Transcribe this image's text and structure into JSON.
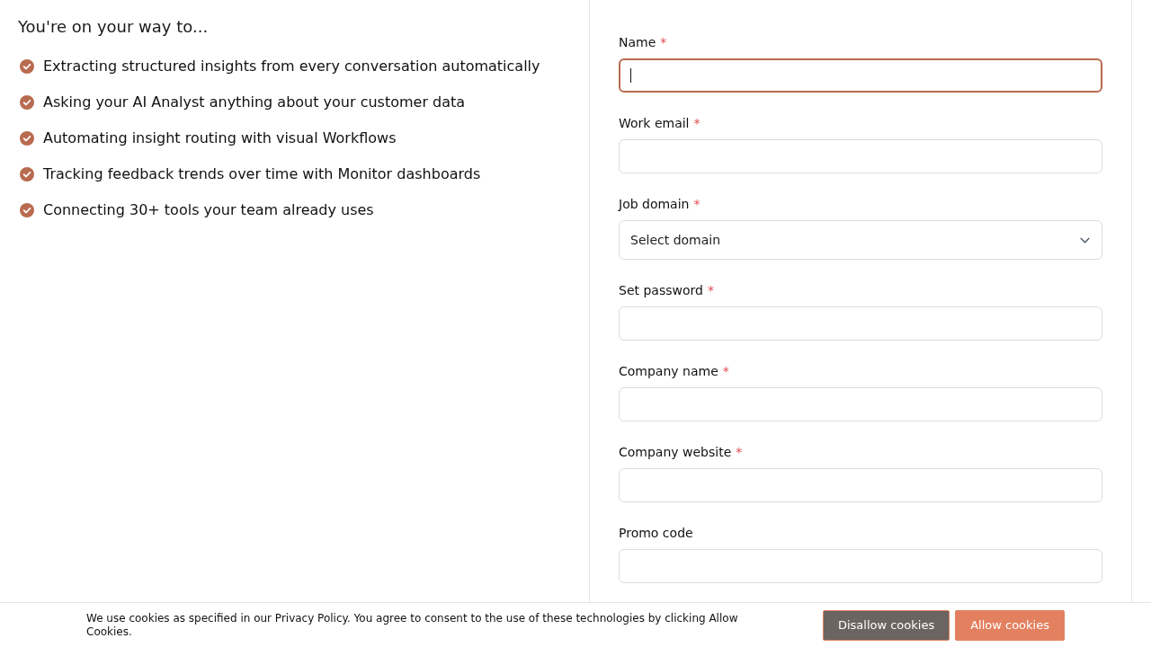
{
  "left": {
    "heading": "You're on your way to...",
    "benefits": [
      {
        "text": "Extracting structured insights from every conversation automatically"
      },
      {
        "text": "Asking your AI Analyst anything about your customer data"
      },
      {
        "text": "Automating insight routing with visual Workflows"
      },
      {
        "text": "Tracking feedback trends over time with Monitor dashboards"
      },
      {
        "text": "Connecting 30+ tools your team already uses"
      }
    ]
  },
  "form": {
    "fields": [
      {
        "label": "Name",
        "required_mark": "*",
        "kind": "text",
        "focused": true
      },
      {
        "label": "Work email",
        "required_mark": "*",
        "kind": "text",
        "focused": false
      },
      {
        "label": "Job domain",
        "required_mark": "*",
        "kind": "select",
        "placeholder": "Select domain",
        "focused": false
      },
      {
        "label": "Set password",
        "required_mark": "*",
        "kind": "text",
        "focused": false
      },
      {
        "label": "Company name",
        "required_mark": "*",
        "kind": "text",
        "focused": false
      },
      {
        "label": "Company website",
        "required_mark": "*",
        "kind": "text",
        "focused": false
      },
      {
        "label": "Promo code",
        "kind": "text",
        "focused": false
      }
    ]
  },
  "cookie_banner": {
    "message": "We use cookies as specified in our Privacy Policy. You agree to consent to the use of these technologies by clicking Allow Cookies.",
    "buttons": [
      {
        "label": "Disallow cookies",
        "kind": "secondary"
      },
      {
        "label": "Allow cookies",
        "kind": "primary"
      }
    ]
  }
}
